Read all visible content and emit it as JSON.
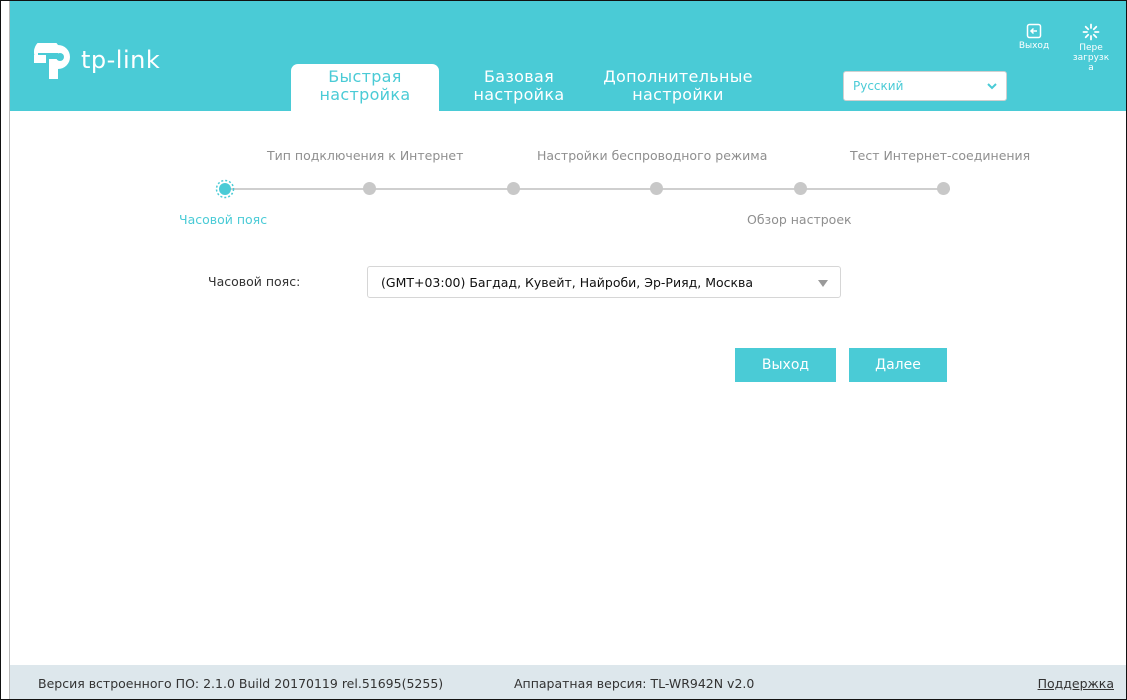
{
  "brand": {
    "logo_text": "tp-link",
    "accent_color": "#4acbd6",
    "footer_color": "#dde7ec"
  },
  "tabs": [
    {
      "line1": "Быстрая",
      "line2": "настройка",
      "active": true
    },
    {
      "line1": "Базовая",
      "line2": "настройка",
      "active": false
    },
    {
      "line1": "Дополнительные",
      "line2": "настройки",
      "active": false
    }
  ],
  "language": {
    "selected": "Русский",
    "icon": "chevron-down-icon"
  },
  "header_actions": {
    "logout": {
      "label": "Выход",
      "icon": "logout-icon"
    },
    "reboot": {
      "label": "Пере загрузк а",
      "icon": "reboot-icon"
    }
  },
  "wizard": {
    "steps": [
      {
        "label": "Часовой пояс",
        "active": true
      },
      {
        "label": "Тип подключения к Интернет",
        "active": false
      },
      {
        "label": "Настройки беспроводного режима",
        "active": false
      },
      {
        "label": "Обзор настроек",
        "active": false
      },
      {
        "label": "Тест Интернет-соединения",
        "active": false
      }
    ]
  },
  "form": {
    "timezone_label": "Часовой пояс:",
    "timezone_value": "(GMT+03:00) Багдад, Кувейт, Найроби, Эр-Рияд, Москва",
    "timezone_arrow_icon": "caret-down-icon"
  },
  "buttons": {
    "exit": "Выход",
    "next": "Далее"
  },
  "footer": {
    "firmware": "Версия встроенного ПО: 2.1.0 Build 20170119 rel.51695(5255)",
    "hardware": "Аппаратная версия: TL-WR942N v2.0",
    "support": "Поддержка"
  }
}
